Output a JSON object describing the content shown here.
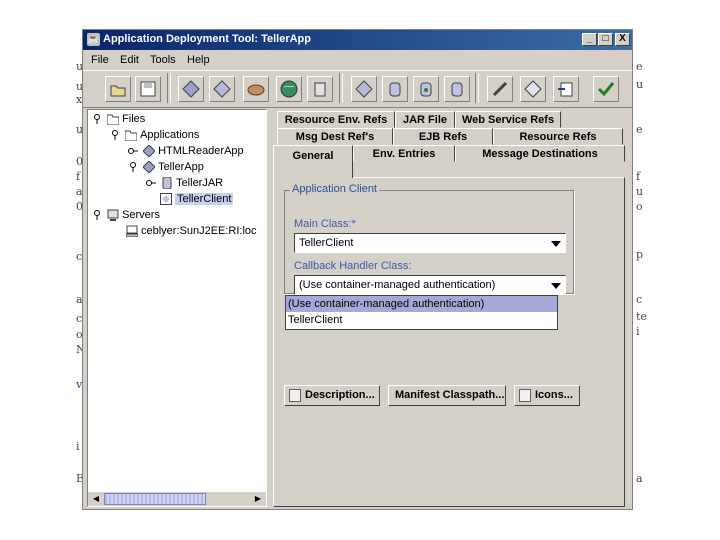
{
  "background_glyphs": [
    "u",
    "u",
    "x",
    "u",
    "0",
    "f",
    "a",
    "0",
    "c",
    "a",
    "c",
    "o",
    "N",
    "v",
    "i",
    "E",
    "e",
    "u",
    "e",
    "f",
    "u",
    "o",
    "p",
    "c",
    "te",
    "i",
    "a"
  ],
  "window": {
    "title": "Application Deployment Tool: TellerApp",
    "buttons": {
      "minimize": "_",
      "maximize": "□",
      "close": "X"
    }
  },
  "menu": [
    "File",
    "Edit",
    "Tools",
    "Help"
  ],
  "toolbar_icons": [
    "open-folder-icon",
    "save-icon",
    "diamond-star-icon",
    "diamond-select-icon",
    "cup-icon",
    "globe-icon",
    "server-add-icon",
    "diamond-add-icon",
    "jar-add-icon",
    "jar-refresh-icon",
    "jar-verify-icon",
    "diamond-edit-icon",
    "document-edit-icon",
    "document-arrow-icon",
    "checkmark-icon"
  ],
  "tree": {
    "files": "Files",
    "applications": "Applications",
    "html_reader_app": "HTMLReaderApp",
    "teller_app": "TellerApp",
    "teller_jar": "TellerJAR",
    "teller_client": "TellerClient",
    "servers": "Servers",
    "server_entry": "ceblyer:SunJ2EE:RI:loc"
  },
  "tabs": {
    "row1": [
      "Resource Env. Refs",
      "JAR File",
      "Web Service Refs"
    ],
    "row2": [
      "Msg Dest Ref's",
      "EJB Refs",
      "Resource Refs"
    ],
    "row3": [
      "General",
      "Env. Entries",
      "Message Destinations"
    ]
  },
  "panel": {
    "group_title": "Application Client",
    "main_class_label": "Main Class:*",
    "main_class_value": "TellerClient",
    "callback_label": "Callback Handler Class:",
    "callback_value": "(Use container-managed authentication)",
    "dropdown_options": [
      "(Use container-managed authentication)",
      "TellerClient"
    ],
    "buttons": [
      "Description...",
      "Manifest Classpath...",
      "Icons..."
    ]
  }
}
